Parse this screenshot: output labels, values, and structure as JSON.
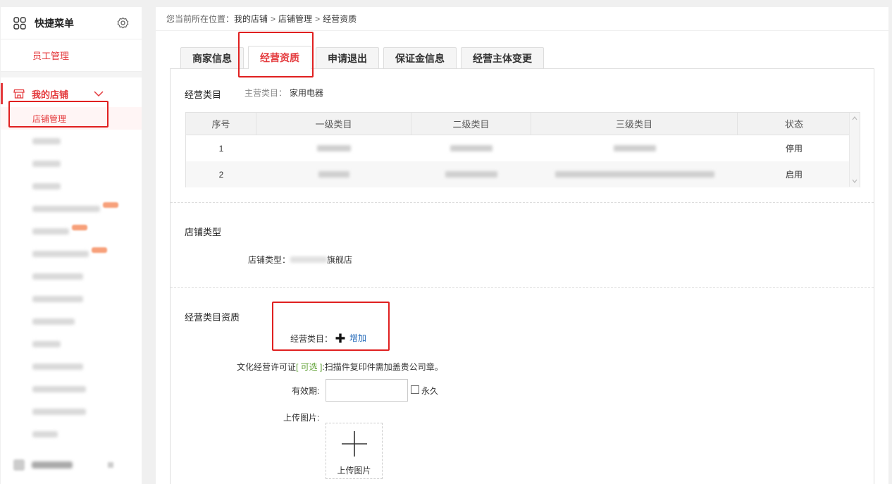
{
  "sidebar": {
    "quick_menu_title": "快捷菜单",
    "quick_items": [
      {
        "label": "员工管理"
      }
    ],
    "store_section": {
      "label": "我的店铺",
      "active_item": "店铺管理"
    },
    "blurred_items": [
      {
        "w": 40
      },
      {
        "w": 40
      },
      {
        "w": 40
      },
      {
        "w": 96,
        "badge": true
      },
      {
        "w": 52,
        "badge": true
      },
      {
        "w": 80,
        "badge": true
      },
      {
        "w": 72
      },
      {
        "w": 72
      },
      {
        "w": 60
      },
      {
        "w": 40
      },
      {
        "w": 72
      },
      {
        "w": 76
      },
      {
        "w": 76
      },
      {
        "w": 36
      }
    ],
    "bottom_section_label": "商品管理"
  },
  "breadcrumb": {
    "prefix": "您当前所在位置：",
    "items": [
      "我的店铺",
      "店铺管理",
      "经营资质"
    ],
    "separator": ">"
  },
  "tabs": [
    {
      "label": "商家信息",
      "active": false
    },
    {
      "label": "经营资质",
      "active": true
    },
    {
      "label": "申请退出",
      "active": false
    },
    {
      "label": "保证金信息",
      "active": false
    },
    {
      "label": "经营主体变更",
      "active": false
    }
  ],
  "category_section": {
    "title": "经营类目",
    "main_category_label": "主营类目：",
    "main_category_value": "家用电器",
    "table": {
      "columns": [
        "序号",
        "一级类目",
        "二级类目",
        "三级类目",
        "状态"
      ],
      "rows": [
        {
          "index": "1",
          "status": "停用",
          "status_type": "off"
        },
        {
          "index": "2",
          "status": "启用",
          "status_type": "on"
        }
      ]
    }
  },
  "store_type_section": {
    "title": "店铺类型",
    "label": "店铺类型：",
    "value_suffix": "旗舰店"
  },
  "qualification_section": {
    "title": "经营类目资质",
    "category_label": "经营类目：",
    "add_label": "增加",
    "license_text_before": "文化经营许可证",
    "license_optional": "[ 可选 ]",
    "license_text_after": ":扫描件复印件需加盖贵公司章。",
    "validity_label": "有效期:",
    "permanent_label": "永久",
    "upload_label": "上传图片:",
    "upload_button_text": "上传图片"
  },
  "colors": {
    "accent": "#e4393c",
    "annotation_red": "#e02020",
    "status_off": "#e07b2a",
    "status_on": "#5a9e2e",
    "link": "#2a6ebb"
  }
}
